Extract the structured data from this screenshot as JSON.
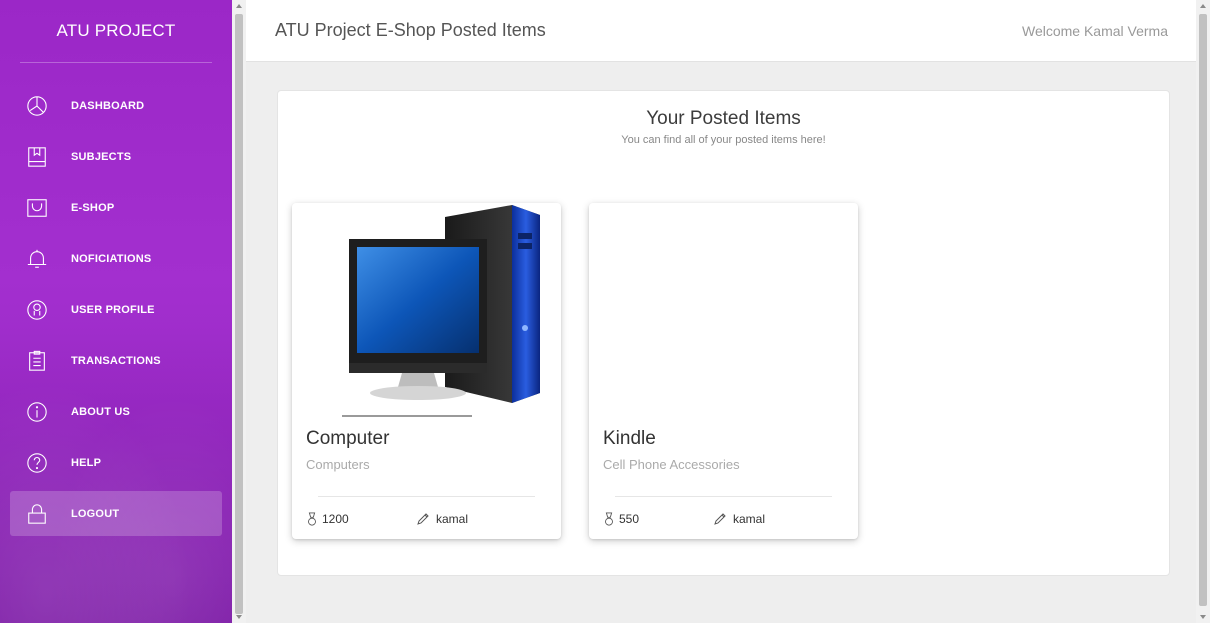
{
  "sidebar": {
    "brand": "ATU PROJECT",
    "items": [
      {
        "label": "DASHBOARD",
        "icon": "dashboard-icon"
      },
      {
        "label": "SUBJECTS",
        "icon": "book-icon"
      },
      {
        "label": "E-SHOP",
        "icon": "shopping-bag-icon"
      },
      {
        "label": "NOFICIATIONS",
        "icon": "bell-icon"
      },
      {
        "label": "USER PROFILE",
        "icon": "user-icon"
      },
      {
        "label": "TRANSACTIONS",
        "icon": "clipboard-icon"
      },
      {
        "label": "ABOUT US",
        "icon": "info-icon"
      },
      {
        "label": "HELP",
        "icon": "help-icon"
      },
      {
        "label": "LOGOUT",
        "icon": "lock-icon",
        "active": true
      }
    ],
    "colors": {
      "gradient_top": "#9b27c7",
      "gradient_bottom": "#8c22b8"
    }
  },
  "header": {
    "title": "ATU Project E-Shop Posted Items",
    "welcome": "Welcome Kamal Verma"
  },
  "panel": {
    "title": "Your Posted Items",
    "subtitle": "You can find all of your posted items here!"
  },
  "items": [
    {
      "name": "Computer",
      "category": "Computers",
      "price": "1200",
      "author": "kamal",
      "has_image": true,
      "image_icon": "computer-icon"
    },
    {
      "name": "Kindle",
      "category": "Cell Phone Accessories",
      "price": "550",
      "author": "kamal",
      "has_image": false
    }
  ]
}
